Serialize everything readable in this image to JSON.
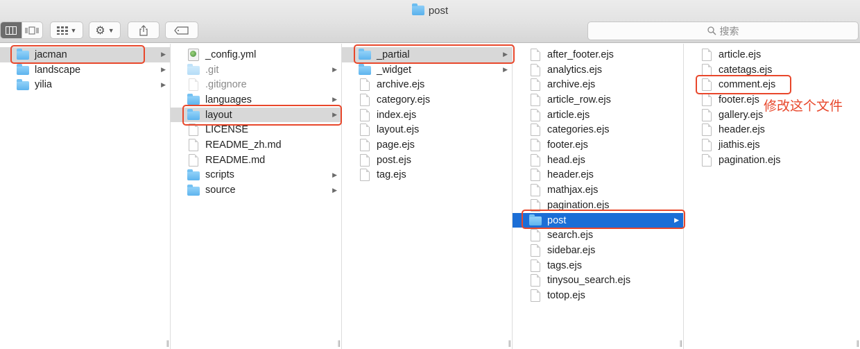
{
  "window": {
    "title": "post"
  },
  "toolbar": {
    "search_placeholder": "搜索"
  },
  "columns": [
    {
      "items": [
        {
          "label": "jacman",
          "kind": "folder",
          "arrow": true,
          "highlight": "gray"
        },
        {
          "label": "landscape",
          "kind": "folder",
          "arrow": true
        },
        {
          "label": "yilia",
          "kind": "folder",
          "arrow": true
        }
      ]
    },
    {
      "items": [
        {
          "label": "_config.yml",
          "kind": "yml"
        },
        {
          "label": ".git",
          "kind": "folder",
          "arrow": true,
          "dim": true
        },
        {
          "label": ".gitignore",
          "kind": "doc",
          "dim": true
        },
        {
          "label": "languages",
          "kind": "folder",
          "arrow": true
        },
        {
          "label": "layout",
          "kind": "folder",
          "arrow": true,
          "highlight": "gray"
        },
        {
          "label": "LICENSE",
          "kind": "doc"
        },
        {
          "label": "README_zh.md",
          "kind": "doc"
        },
        {
          "label": "README.md",
          "kind": "doc"
        },
        {
          "label": "scripts",
          "kind": "folder",
          "arrow": true
        },
        {
          "label": "source",
          "kind": "folder",
          "arrow": true
        }
      ]
    },
    {
      "items": [
        {
          "label": "_partial",
          "kind": "folder",
          "arrow": true,
          "highlight": "gray"
        },
        {
          "label": "_widget",
          "kind": "folder",
          "arrow": true
        },
        {
          "label": "archive.ejs",
          "kind": "doc"
        },
        {
          "label": "category.ejs",
          "kind": "doc"
        },
        {
          "label": "index.ejs",
          "kind": "doc"
        },
        {
          "label": "layout.ejs",
          "kind": "doc"
        },
        {
          "label": "page.ejs",
          "kind": "doc"
        },
        {
          "label": "post.ejs",
          "kind": "doc"
        },
        {
          "label": "tag.ejs",
          "kind": "doc"
        }
      ]
    },
    {
      "items": [
        {
          "label": "after_footer.ejs",
          "kind": "doc"
        },
        {
          "label": "analytics.ejs",
          "kind": "doc"
        },
        {
          "label": "archive.ejs",
          "kind": "doc"
        },
        {
          "label": "article_row.ejs",
          "kind": "doc"
        },
        {
          "label": "article.ejs",
          "kind": "doc"
        },
        {
          "label": "categories.ejs",
          "kind": "doc"
        },
        {
          "label": "footer.ejs",
          "kind": "doc"
        },
        {
          "label": "head.ejs",
          "kind": "doc"
        },
        {
          "label": "header.ejs",
          "kind": "doc"
        },
        {
          "label": "mathjax.ejs",
          "kind": "doc"
        },
        {
          "label": "pagination.ejs",
          "kind": "doc"
        },
        {
          "label": "post",
          "kind": "folder",
          "arrow": true,
          "highlight": "blue"
        },
        {
          "label": "search.ejs",
          "kind": "doc"
        },
        {
          "label": "sidebar.ejs",
          "kind": "doc"
        },
        {
          "label": "tags.ejs",
          "kind": "doc"
        },
        {
          "label": "tinysou_search.ejs",
          "kind": "doc"
        },
        {
          "label": "totop.ejs",
          "kind": "doc"
        }
      ]
    },
    {
      "items": [
        {
          "label": "article.ejs",
          "kind": "doc"
        },
        {
          "label": "catetags.ejs",
          "kind": "doc"
        },
        {
          "label": "comment.ejs",
          "kind": "doc"
        },
        {
          "label": "footer.ejs",
          "kind": "doc"
        },
        {
          "label": "gallery.ejs",
          "kind": "doc"
        },
        {
          "label": "header.ejs",
          "kind": "doc"
        },
        {
          "label": "jiathis.ejs",
          "kind": "doc"
        },
        {
          "label": "pagination.ejs",
          "kind": "doc"
        }
      ]
    }
  ],
  "annotation": {
    "text": "修改这个文件",
    "color": "#e8472b"
  },
  "colors": {
    "selection_blue": "#1b6ed6",
    "inactive_selection": "#d8d8d8",
    "annotation_red": "#e8472b"
  },
  "icons": {
    "folder": "folder-icon",
    "document": "document-icon",
    "yml": "yml-file-icon"
  }
}
